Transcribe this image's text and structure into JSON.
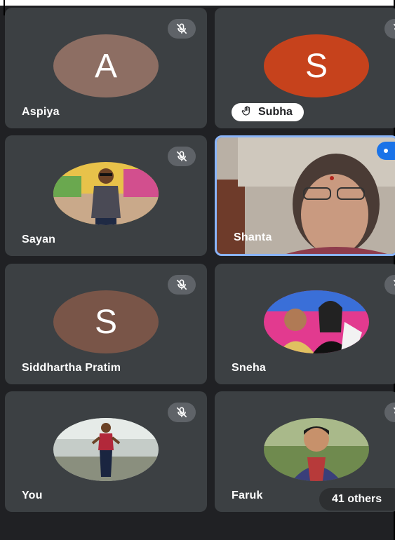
{
  "participants": [
    {
      "name": "Aspiya",
      "initial": "A",
      "avatar_color": "#8d6e63",
      "muted": true
    },
    {
      "name": "Subha",
      "initial": "S",
      "avatar_color": "#c6421c",
      "muted": true,
      "hand_raised": true
    },
    {
      "name": "Sayan",
      "muted": true,
      "avatar": "photo"
    },
    {
      "name": "Shanta",
      "video": true,
      "speaking": true
    },
    {
      "name": "Siddhartha Pratim",
      "initial": "S",
      "avatar_color": "#795548",
      "muted": true
    },
    {
      "name": "Sneha",
      "muted": true,
      "avatar": "photo"
    },
    {
      "name": "You",
      "muted": true,
      "avatar": "photo"
    },
    {
      "name": "Faruk",
      "muted": true,
      "avatar": "photo"
    }
  ],
  "others_label": "41 others",
  "icons": {
    "mute": "mic-off-icon",
    "hand": "raised-hand-icon"
  },
  "colors": {
    "tile": "#3c4043",
    "background": "#202124",
    "active_border": "#8ab4f8"
  }
}
